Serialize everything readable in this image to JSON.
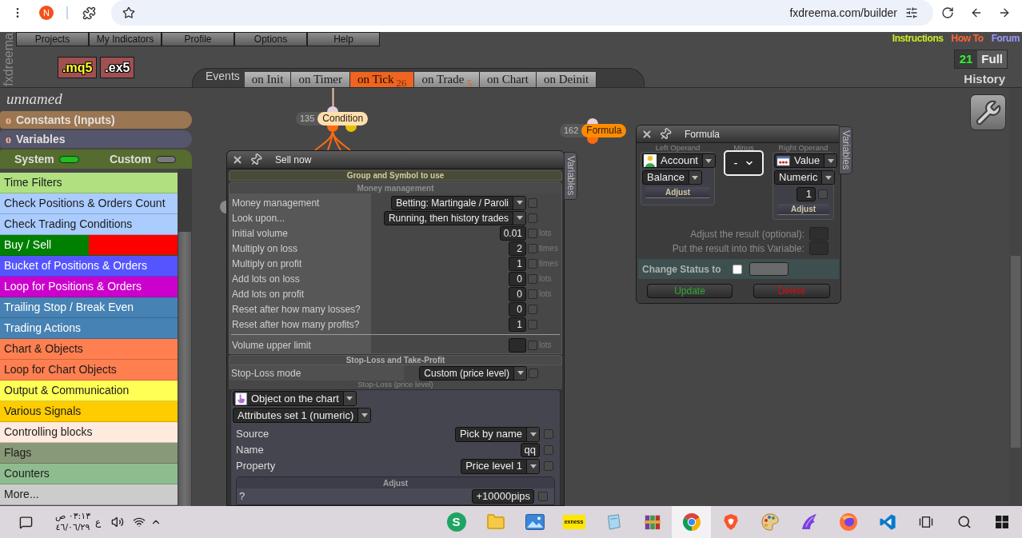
{
  "browser": {
    "profile_initial": "N",
    "url": "fxdreema.com/builder"
  },
  "logo": "fxdreema",
  "menu": [
    "Projects",
    "My Indicators",
    "Profile",
    "Options",
    "Help"
  ],
  "export_buttons": [
    {
      "label": ".mq5",
      "kind": "source"
    },
    {
      "label": ".ex5",
      "kind": "compiled"
    }
  ],
  "header_links": [
    {
      "label": "Instructions",
      "color": "#ccee22"
    },
    {
      "label": "How To",
      "color": "#ff6633"
    },
    {
      "label": "Forum",
      "color": "#9999ff"
    }
  ],
  "history": {
    "count": "21",
    "mode": "Full",
    "label": "History"
  },
  "events": {
    "label": "Events",
    "tabs": [
      {
        "label": "on Init",
        "selected": false
      },
      {
        "label": "on Timer",
        "selected": false
      },
      {
        "label": "on Tick",
        "count": "26",
        "selected": true
      },
      {
        "label": "on Trade",
        "count": "5",
        "selected": false
      },
      {
        "label": "on Chart",
        "selected": false
      },
      {
        "label": "on Deinit",
        "selected": false
      }
    ]
  },
  "sidebar": {
    "project_name": "unnamed",
    "sections": [
      {
        "bullet": "o",
        "label": "Constants (Inputs)",
        "color": "#9b7653"
      },
      {
        "bullet": "o",
        "label": "Variables",
        "color": "#55556b"
      }
    ],
    "toggles": [
      {
        "label": "System",
        "on": true
      },
      {
        "label": "Custom",
        "on": false
      }
    ],
    "items": [
      {
        "label": "Time Filters",
        "color": "#b0e080"
      },
      {
        "label": "Check Positions & Orders Count",
        "color": "#aaccff"
      },
      {
        "label": "Check Trading Conditions",
        "color": "#aaccff"
      },
      {
        "label": "Buy / Sell",
        "color": "#008000",
        "band": {
          "color": "#ff0000"
        }
      },
      {
        "label": "Bucket of Positions & Orders",
        "color": "#5555ff"
      },
      {
        "label": "Loop for Positions & Orders",
        "color": "#cc00cc"
      },
      {
        "label": "Trailing Stop / Break Even",
        "color": "#4682b4"
      },
      {
        "label": "Trading Actions",
        "color": "#4682b4"
      },
      {
        "label": "Chart & Objects",
        "color": "#ff7f50"
      },
      {
        "label": "Loop for Chart Objects",
        "color": "#ff7f50"
      },
      {
        "label": "Output & Communication",
        "color": "#ffff55"
      },
      {
        "label": "Various Signals",
        "color": "#ffcc00"
      },
      {
        "label": "Controlling blocks",
        "color": "#ffeadd"
      },
      {
        "label": "Flags",
        "color": "#889977"
      },
      {
        "label": "Counters",
        "color": "#8fbc8f"
      },
      {
        "label": "More...",
        "color": "#cccccc"
      }
    ]
  },
  "canvas": {
    "nodes": [
      {
        "kind": "condition",
        "number": "135",
        "label": "Condition",
        "color": "#ffdfb0"
      },
      {
        "kind": "formula",
        "number": "162",
        "label": "Formula",
        "color": "#ff8c00"
      }
    ],
    "sell_dialog": {
      "title": "Sell now",
      "side_tab": "Variables",
      "group_header": "Group and Symbol to use",
      "money": {
        "title": "Money management",
        "rows": [
          {
            "kind": "select",
            "label": "Money management",
            "value": "Betting: Martingale / Paroli",
            "checked": false
          },
          {
            "kind": "select",
            "label": "Look upon...",
            "value": "Running, then history trades",
            "checked": false
          },
          {
            "kind": "input",
            "label": "Initial volume",
            "value": "0.01",
            "unit": "lots",
            "checked": false
          },
          {
            "kind": "input",
            "label": "Multiply on loss",
            "value": "2",
            "unit": "times",
            "checked": false
          },
          {
            "kind": "input",
            "label": "Multiply on profit",
            "value": "1",
            "unit": "times",
            "checked": false
          },
          {
            "kind": "input",
            "label": "Add lots on loss",
            "value": "0",
            "unit": "lots",
            "checked": false
          },
          {
            "kind": "input",
            "label": "Add lots on profit",
            "value": "0",
            "unit": "lots",
            "checked": false
          },
          {
            "kind": "input",
            "label": "Reset after how many losses?",
            "value": "0",
            "checked": false
          },
          {
            "kind": "input",
            "label": "Reset after how many profits?",
            "value": "1",
            "checked": false
          },
          {
            "kind": "divider"
          },
          {
            "kind": "input",
            "label": "Volume upper limit",
            "unit": "lots",
            "checked": false
          }
        ]
      },
      "stop_loss": {
        "title": "Stop-Loss and Take-Profit",
        "rows": [
          {
            "kind": "select",
            "label": "Stop-Loss mode",
            "value": "Custom (price level)",
            "checked": false
          }
        ],
        "caption": "Stop-Loss (price level)",
        "panel": {
          "selects": [
            "Object on the chart",
            "Attributes set 1 (numeric)"
          ],
          "rows": [
            {
              "kind": "select",
              "label": "Source",
              "value": "Pick by name",
              "checked": false
            },
            {
              "kind": "input",
              "label": "Name",
              "value": "qq",
              "checked": false
            },
            {
              "kind": "select",
              "label": "Property",
              "value": "Price level 1",
              "checked": false
            }
          ],
          "adjust": {
            "title": "Adjust",
            "rows": [
              {
                "kind": "input",
                "label": "?",
                "value": "+10000pips",
                "checked": false
              }
            ]
          }
        }
      }
    },
    "formula_dialog": {
      "title": "Formula",
      "side_tab": "Variables",
      "left_operand": {
        "caption": "Left Operand",
        "selects": [
          "Account",
          "Balance"
        ],
        "button": "Adjust"
      },
      "operator": {
        "caption": "Minus",
        "value": "-"
      },
      "right_operand": {
        "caption": "Right Operand",
        "selects": [
          "Value",
          "Numeric"
        ],
        "value": "1",
        "checked": false,
        "button": "Adjust"
      },
      "fields": [
        {
          "label": "Adjust the result (optional):"
        },
        {
          "label": "Put the result into this Variable:"
        }
      ],
      "change_status": {
        "label": "Change Status to",
        "checked": false
      },
      "buttons": [
        {
          "kind": "update",
          "label": "Update"
        },
        {
          "kind": "delete",
          "label": "Delete"
        }
      ]
    }
  },
  "taskbar": {
    "time": "٠٣:١٣ ص",
    "date": "٤٦/٠٦/٢٩",
    "language": "ع",
    "apps": [
      {
        "kind": "letter",
        "label": "S",
        "selected": false
      },
      {
        "kind": "folder",
        "selected": false
      },
      {
        "kind": "photos",
        "selected": false
      },
      {
        "kind": "tile",
        "label": "exness",
        "selected": false
      },
      {
        "kind": "page",
        "selected": false
      },
      {
        "kind": "books",
        "selected": false
      },
      {
        "kind": "circle",
        "selected": true
      },
      {
        "kind": "shield",
        "selected": false
      },
      {
        "kind": "palette",
        "selected": false
      },
      {
        "kind": "wing",
        "selected": false
      },
      {
        "kind": "ring",
        "selected": false
      },
      {
        "kind": "ribbon",
        "selected": false
      }
    ]
  }
}
